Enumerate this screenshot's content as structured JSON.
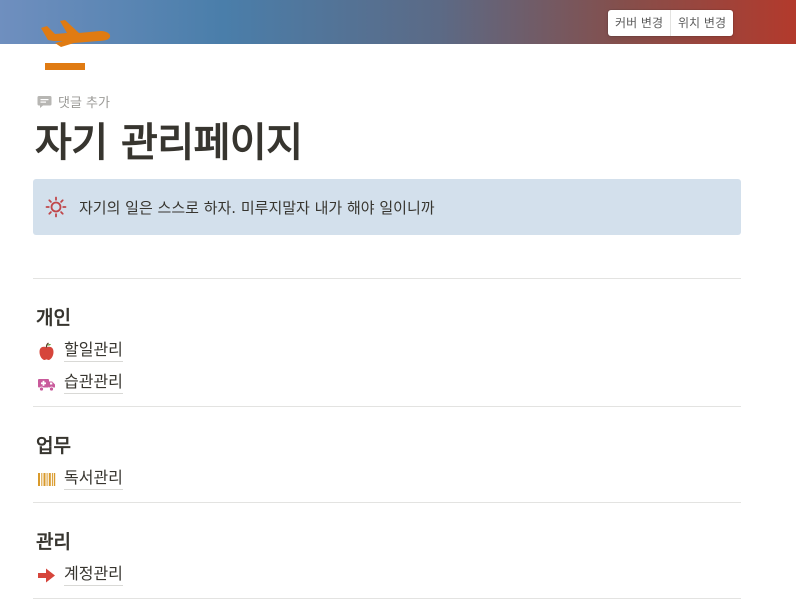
{
  "cover": {
    "change_cover_label": "커버 변경",
    "reposition_label": "위치 변경",
    "gradient": [
      "#6f8fbf",
      "#4a7eaa",
      "#5b6a86",
      "#844f4c",
      "#b33a2c"
    ]
  },
  "page_icon": {
    "name": "airplane-departure-icon",
    "color": "#e07b12"
  },
  "add_comment_label": "댓글 추가",
  "title": "자기 관리페이지",
  "callout": {
    "icon": "sun-icon",
    "icon_color": "#c0464a",
    "text": "자기의 일은 스스로 하자. 미루지말자 내가 해야 일이니까",
    "background": "#d3e0ec"
  },
  "sections": [
    {
      "heading": "개인",
      "items": [
        {
          "icon": "apple-icon",
          "label": "할일관리"
        },
        {
          "icon": "truck-icon",
          "label": "습관관리"
        }
      ]
    },
    {
      "heading": "업무",
      "items": [
        {
          "icon": "barcode-icon",
          "label": "독서관리"
        }
      ]
    },
    {
      "heading": "관리",
      "items": [
        {
          "icon": "arrow-right-icon",
          "label": "계정관리"
        }
      ]
    }
  ]
}
